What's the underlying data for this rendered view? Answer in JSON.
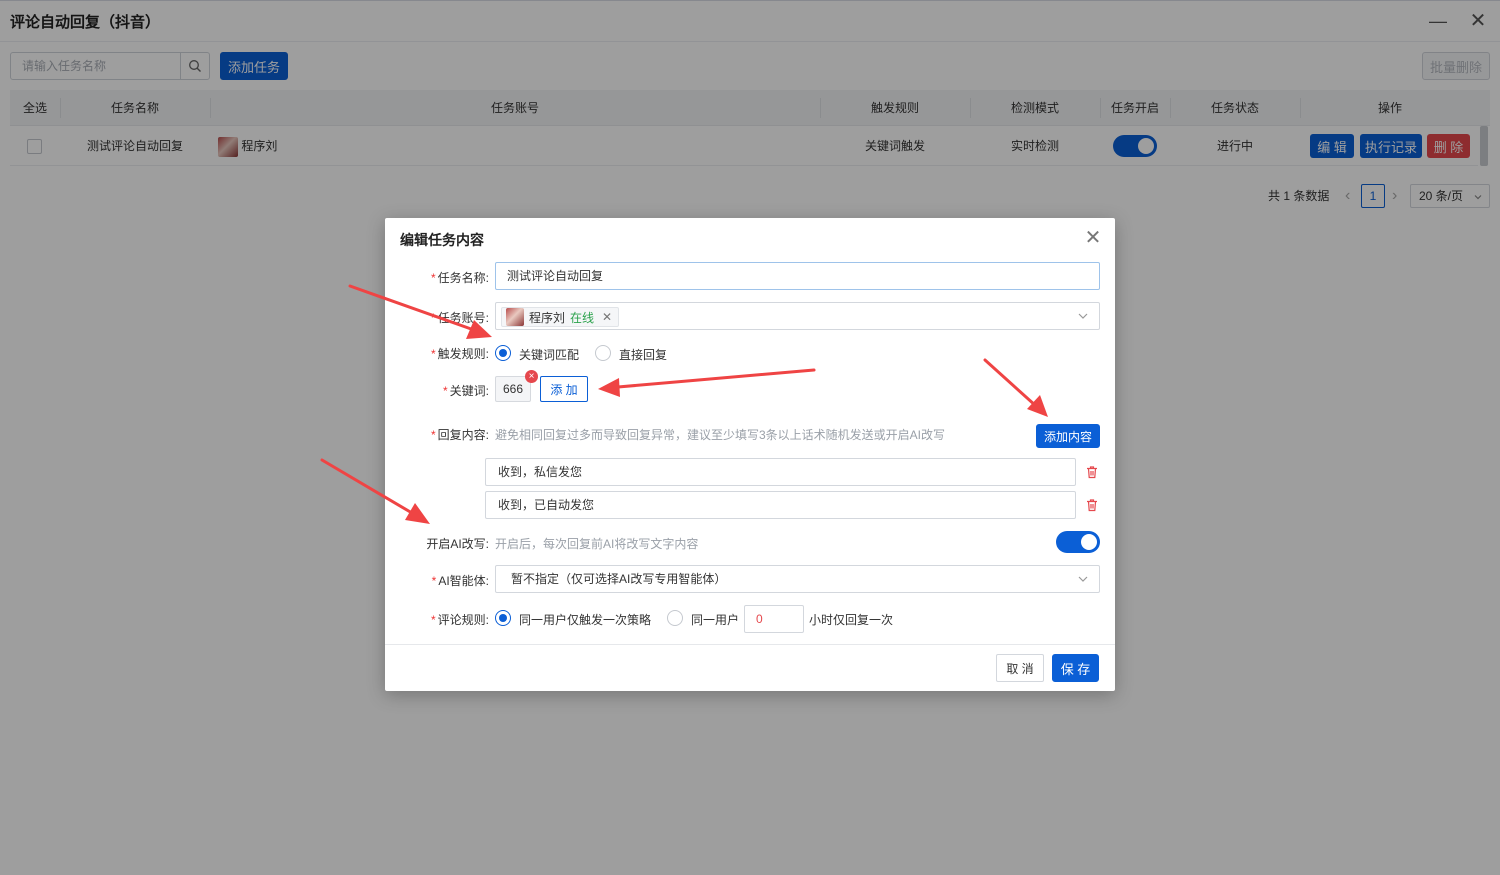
{
  "window": {
    "title": "评论自动回复（抖音）",
    "minimize": "—",
    "close": "✕"
  },
  "toolbar": {
    "search_placeholder": "请输入任务名称",
    "add_task_label": "添加任务",
    "batch_delete_label": "批量删除"
  },
  "table": {
    "headers": [
      "全选",
      "任务名称",
      "任务账号",
      "触发规则",
      "检测模式",
      "任务开启",
      "任务状态",
      "操作"
    ],
    "rows": [
      {
        "task_name": "测试评论自动回复",
        "account": "程序刘",
        "trigger_rule": "关键词触发",
        "detect_mode": "实时检测",
        "enabled": true,
        "status": "进行中",
        "actions": {
          "edit": "编 辑",
          "log": "执行记录",
          "delete": "删 除"
        }
      }
    ]
  },
  "pagination": {
    "total_text": "共 1 条数据",
    "prev": "‹",
    "page": "1",
    "next": "›",
    "page_size": "20 条/页"
  },
  "modal": {
    "title": "编辑任务内容",
    "close": "✕",
    "task_name": {
      "label": "任务名称:",
      "value": "测试评论自动回复"
    },
    "account": {
      "label": "任务账号:",
      "chip_name": "程序刘",
      "chip_status": "在线",
      "chip_remove": "✕"
    },
    "trigger": {
      "label": "触发规则:",
      "options": [
        "关键词匹配",
        "直接回复"
      ],
      "selected": "关键词匹配"
    },
    "keyword": {
      "label": "关键词:",
      "tags": [
        "666"
      ],
      "add_label": "添 加"
    },
    "reply": {
      "label": "回复内容:",
      "hint": "避免相同回复过多而导致回复异常，建议至少填写3条以上话术随机发送或开启AI改写",
      "add_label": "添加内容",
      "items": [
        "收到，私信发您",
        "收到，已自动发您"
      ]
    },
    "ai_rewrite": {
      "label": "开启AI改写:",
      "hint": "开启后，每次回复前AI将改写文字内容",
      "enabled": true
    },
    "ai_agent": {
      "label": "AI智能体:",
      "value": "暂不指定（仅可选择AI改写专用智能体）"
    },
    "comment_rule": {
      "label": "评论规则:",
      "option1": "同一用户仅触发一次策略",
      "option2_prefix": "同一用户",
      "hours": "0",
      "option2_suffix": "小时仅回复一次",
      "selected": "option1"
    },
    "cancel_label": "取 消",
    "save_label": "保 存"
  },
  "colors": {
    "primary": "#0b5fd6",
    "danger": "#e5484d",
    "online": "#2ba24c",
    "arrow": "#ef4444"
  }
}
